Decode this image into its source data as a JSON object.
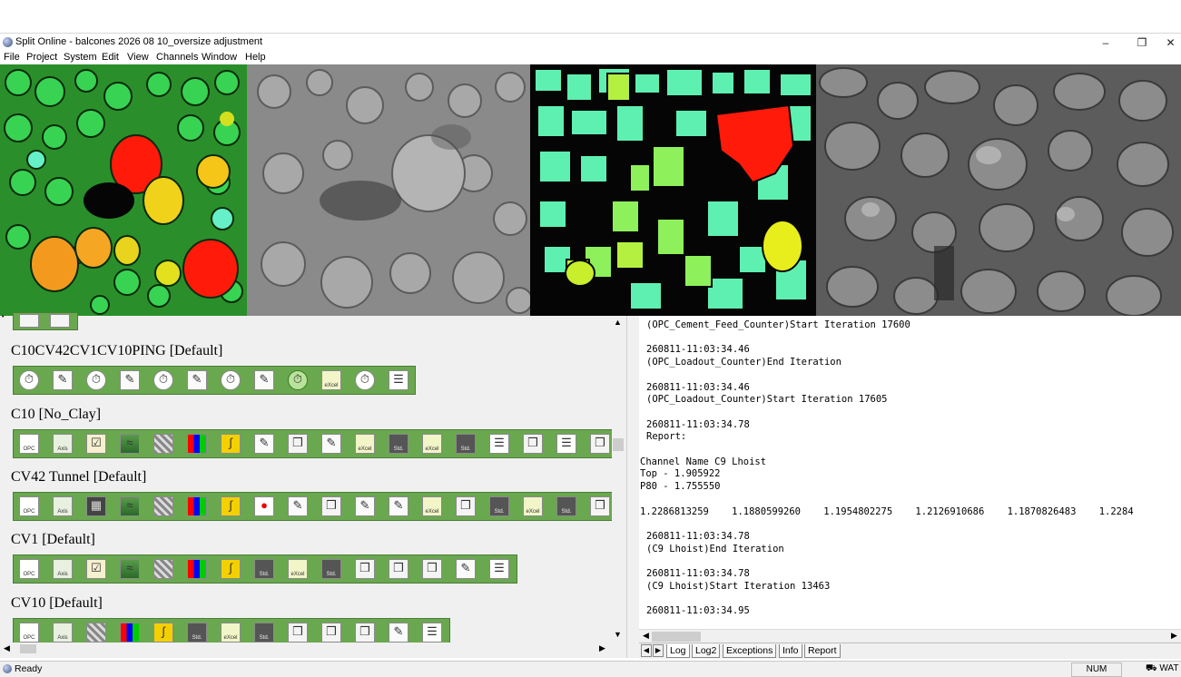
{
  "window": {
    "title": "Split Online - balcones 2026 08 10_oversize adjustment",
    "minimize": "–",
    "maximize": "❐",
    "close": "✕"
  },
  "menu": [
    "File",
    "Project",
    "System",
    "Edit",
    "View",
    "Channels",
    "Window",
    "Help"
  ],
  "channels": [
    {
      "label": "C10CV42CV1CV10PING [Default]"
    },
    {
      "label": "C10 [No_Clay]"
    },
    {
      "label": "CV42 Tunnel [Default]"
    },
    {
      "label": "CV1 [Default]"
    },
    {
      "label": "CV10 [Default]"
    }
  ],
  "tool_text": {
    "opc": "OPC",
    "axis": "Axis",
    "excel": "eXcel",
    "std": "Std."
  },
  "log_lines": [
    "(OPC_Cement_Feed_Counter)Start Iteration 17600",
    "",
    "260811-11:03:34.46",
    "(OPC_Loadout_Counter)End Iteration",
    "",
    "260811-11:03:34.46",
    "(OPC_Loadout_Counter)Start Iteration 17605",
    "",
    "260811-11:03:34.78",
    "Report:",
    "",
    "Channel Name C9 Lhoist",
    "Top - 1.905922",
    "P80 - 1.755550",
    "",
    "1.2286813259    1.1880599260    1.1954802275    1.2126910686    1.1870826483    1.2284",
    "",
    "260811-11:03:34.78",
    "(C9 Lhoist)End Iteration",
    "",
    "260811-11:03:34.78",
    "(C9 Lhoist)Start Iteration 13463",
    "",
    "260811-11:03:34.95"
  ],
  "tabs": [
    "Log",
    "Log2",
    "Exceptions",
    "Info",
    "Report"
  ],
  "status": {
    "left": "Ready",
    "num": "NUM",
    "wat": "WAT"
  }
}
